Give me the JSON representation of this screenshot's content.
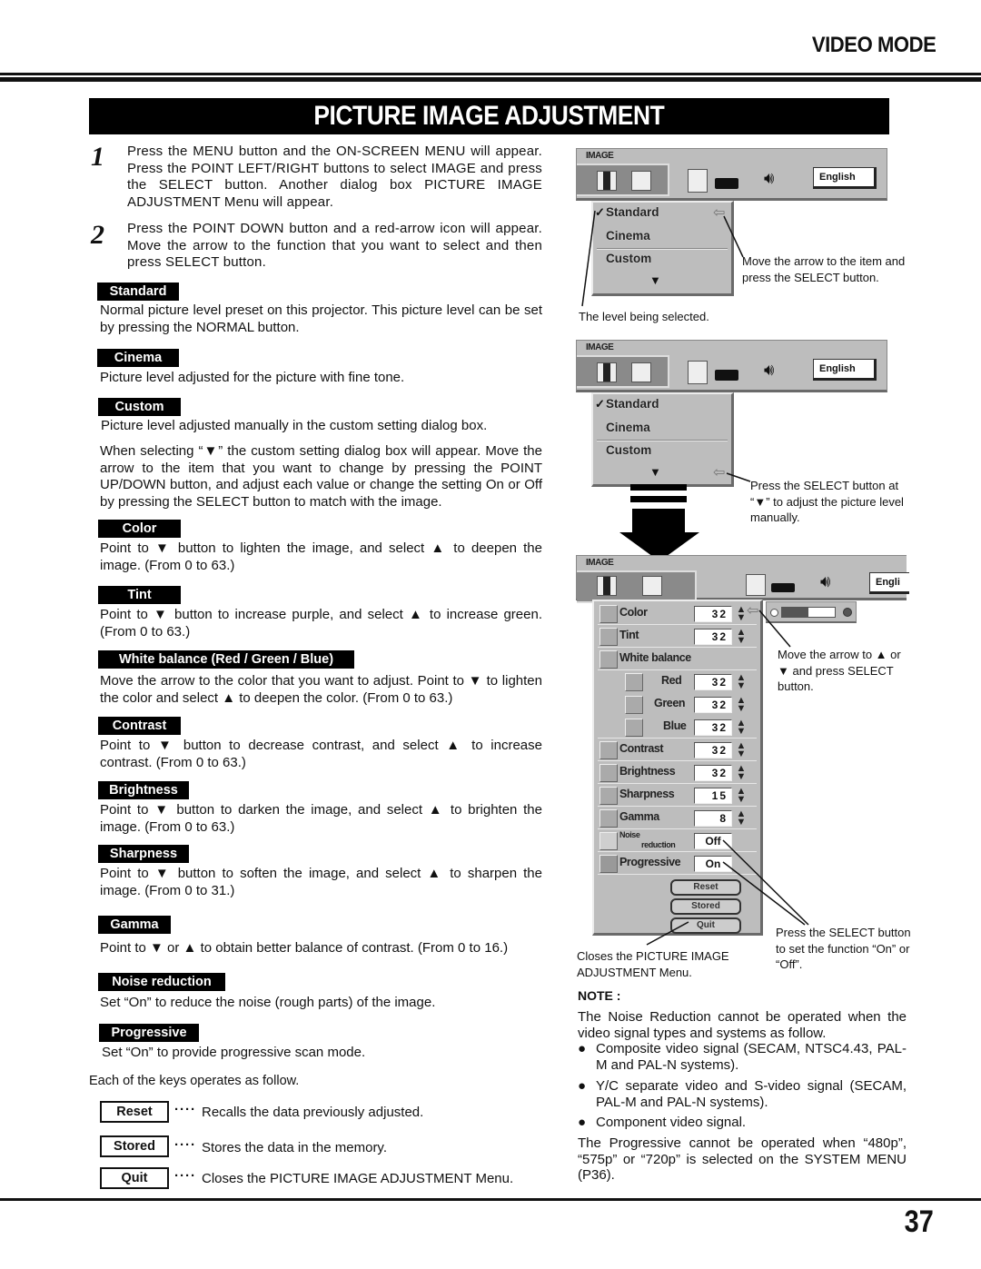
{
  "header": {
    "section": "VIDEO MODE",
    "title": "PICTURE IMAGE ADJUSTMENT"
  },
  "steps": [
    {
      "number": "1",
      "text": "Press the MENU button and the ON-SCREEN MENU will appear. Press the POINT LEFT/RIGHT buttons to select IMAGE and press the SELECT button. Another dialog box PICTURE IMAGE ADJUSTMENT Menu will appear."
    },
    {
      "number": "2",
      "text": "Press the POINT DOWN button and a red-arrow icon will appear. Move the arrow to the function that you want to select and then press SELECT button."
    }
  ],
  "sections": {
    "standard": {
      "label": "Standard",
      "text": "Normal picture level preset on this projector.  This picture level can be set by pressing the NORMAL button."
    },
    "cinema": {
      "label": "Cinema",
      "text": "Picture level adjusted for the picture with fine tone."
    },
    "custom": {
      "label": "Custom",
      "text": "Picture level adjusted manually in the custom setting dialog box.",
      "text2": "When selecting “▼” the custom setting dialog box will appear.  Move the arrow to the item that you want to change by pressing the POINT UP/DOWN button, and adjust each value or change the setting On or Off by pressing the SELECT button to match with the image."
    },
    "color": {
      "label": "Color",
      "text": "Point to ▼ button to lighten the image, and select ▲ to deepen the image. (From 0 to 63.)"
    },
    "tint": {
      "label": "Tint",
      "text": "Point to ▼ button to increase purple, and select ▲ to increase green. (From 0 to 63.)"
    },
    "white_balance": {
      "label": "White balance (Red / Green / Blue)",
      "text": "Move the arrow to the color that you want to adjust.  Point to ▼ to lighten the color and select ▲ to deepen the color. (From 0 to 63.)"
    },
    "contrast": {
      "label": "Contrast",
      "text": "Point to ▼ button to decrease contrast, and select ▲ to increase contrast. (From 0 to 63.)"
    },
    "brightness": {
      "label": "Brightness",
      "text": "Point to ▼ button to darken the image, and select ▲ to brighten the image. (From 0 to 63.)"
    },
    "sharpness": {
      "label": "Sharpness",
      "text": "Point to ▼ button to soften the image, and select ▲ to sharpen the image. (From 0 to 31.)"
    },
    "gamma": {
      "label": "Gamma",
      "text": "Point to ▼ or ▲ to obtain better balance of contrast. (From 0 to 16.)"
    },
    "noise_reduction": {
      "label": "Noise reduction",
      "text": "Set “On” to reduce the noise (rough parts) of the image."
    },
    "progressive": {
      "label": "Progressive",
      "text": "Set “On” to provide progressive scan mode."
    }
  },
  "keys": {
    "intro": "Each of the keys operates as follow.",
    "dots": "····",
    "items": [
      {
        "key": "Reset",
        "text": "Recalls the data previously adjusted."
      },
      {
        "key": "Stored",
        "text": "Stores the data in the memory."
      },
      {
        "key": "Quit",
        "text": "Closes the PICTURE IMAGE ADJUSTMENT Menu."
      }
    ]
  },
  "osd": {
    "menu_title": "IMAGE",
    "language": "English",
    "language_cut": "Engli",
    "levels": [
      "Standard",
      "Cinema",
      "Custom"
    ],
    "checkmark": "✓",
    "down_arrow": "▼",
    "custom_rows": [
      {
        "label": "Color",
        "value": "32"
      },
      {
        "label": "Tint",
        "value": "32"
      },
      {
        "label": "White balance",
        "value": ""
      },
      {
        "label": "Red",
        "value": "32"
      },
      {
        "label": "Green",
        "value": "32"
      },
      {
        "label": "Blue",
        "value": "32"
      },
      {
        "label": "Contrast",
        "value": "32"
      },
      {
        "label": "Brightness",
        "value": "32"
      },
      {
        "label": "Sharpness",
        "value": "15"
      },
      {
        "label": "Gamma",
        "value": "8"
      },
      {
        "label": "Noise reduction",
        "label_line1": "Noise",
        "label_line2": "reduction",
        "value": "Off"
      },
      {
        "label": "Progressive",
        "value": "On"
      }
    ],
    "buttons": [
      "Reset",
      "Stored",
      "Quit"
    ],
    "spin_glyph": "▲▼",
    "color_slider_fraction": 0.5
  },
  "callouts": {
    "move_arrow_item": "Move the arrow to the item and press the SELECT button.",
    "level_selected": "The level being selected.",
    "press_select_down": "Press the SELECT button at “▼” to adjust the picture level manually.",
    "move_arrow_updown": "Move the arrow to ▲ or ▼  and press SELECT button.",
    "press_select_onoff": "Press the SELECT button to set the function “On” or “Off”.",
    "closes_menu": "Closes the PICTURE IMAGE ADJUSTMENT Menu."
  },
  "note": {
    "title": "NOTE :",
    "intro": "The Noise Reduction cannot be operated when the video signal types and systems as follow.",
    "bullets": [
      "Composite video signal (SECAM, NTSC4.43, PAL-M and PAL-N systems).",
      "Y/C separate video and S-video signal (SECAM, PAL-M and PAL-N systems).",
      "Component video signal."
    ],
    "bullet_glyph": "●",
    "progressive": "The Progressive cannot be operated when “480p”, “575p” or “720p” is selected on the SYSTEM MENU (P36)."
  },
  "footer": {
    "page_number": "37"
  }
}
